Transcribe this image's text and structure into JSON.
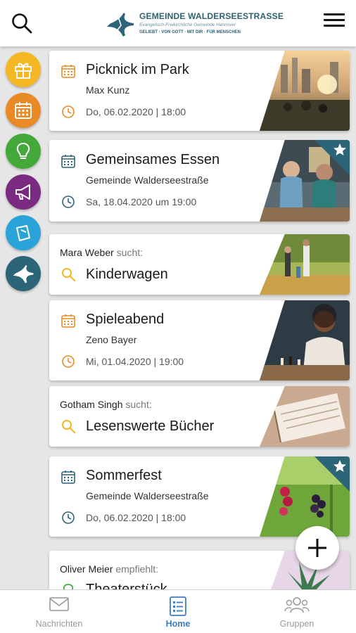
{
  "header": {
    "logo_title": "GEMEINDE WALDERSEESTRASSE",
    "logo_subtitle": "Evangelisch-Freikirchliche Gemeinde Hannover",
    "logo_tagline": "GELIEBT · VON GOTT · MIT DIR · FÜR MENSCHEN"
  },
  "categories": [
    {
      "icon": "gift-icon",
      "color": "#f3b823"
    },
    {
      "icon": "calendar-icon",
      "color": "#ea8a26"
    },
    {
      "icon": "lightbulb-icon",
      "color": "#45a83a"
    },
    {
      "icon": "megaphone-icon",
      "color": "#7b2a82"
    },
    {
      "icon": "note-icon",
      "color": "#2aa3d8"
    },
    {
      "icon": "church-logo-icon",
      "color": "#2c6478"
    }
  ],
  "feed": [
    {
      "type": "event",
      "title": "Picknick im Park",
      "organizer": "Max Kunz",
      "date": "Do, 06.02.2020 | 18:00",
      "icon_color": "#ea8a26",
      "featured": false
    },
    {
      "type": "event",
      "title": "Gemeinsames Essen",
      "organizer": "Gemeinde Walderseestraße",
      "date": "Sa, 18.04.2020 um 19:00",
      "icon_color": "#2c6478",
      "featured": true
    },
    {
      "type": "search",
      "person": "Mara Weber",
      "verb": "sucht:",
      "title": "Kinderwagen",
      "icon_color": "#f3b823"
    },
    {
      "type": "event",
      "title": "Spieleabend",
      "organizer": "Zeno Bayer",
      "date": "Mi, 01.04.2020 | 19:00",
      "icon_color": "#ea8a26",
      "featured": false
    },
    {
      "type": "search",
      "person": "Gotham Singh",
      "verb": "sucht:",
      "title": "Lesenswerte Bücher",
      "icon_color": "#f3b823"
    },
    {
      "type": "event",
      "title": "Sommerfest",
      "organizer": "Gemeinde Walderseestraße",
      "date": "Do, 06.02.2020 | 18:00",
      "icon_color": "#2c6478",
      "featured": true
    },
    {
      "type": "recommend",
      "person": "Oliver Meier",
      "verb": "empfiehlt:",
      "title": "Theaterstück",
      "icon_color": "#45a83a"
    }
  ],
  "tabs": [
    {
      "label": "Nachrichten",
      "icon": "envelope-icon",
      "active": false
    },
    {
      "label": "Home",
      "icon": "list-icon",
      "active": true
    },
    {
      "label": "Gruppen",
      "icon": "people-icon",
      "active": false
    }
  ],
  "colors": {
    "accent": "#3b7ec2",
    "featured_ribbon": "#2c6478"
  }
}
